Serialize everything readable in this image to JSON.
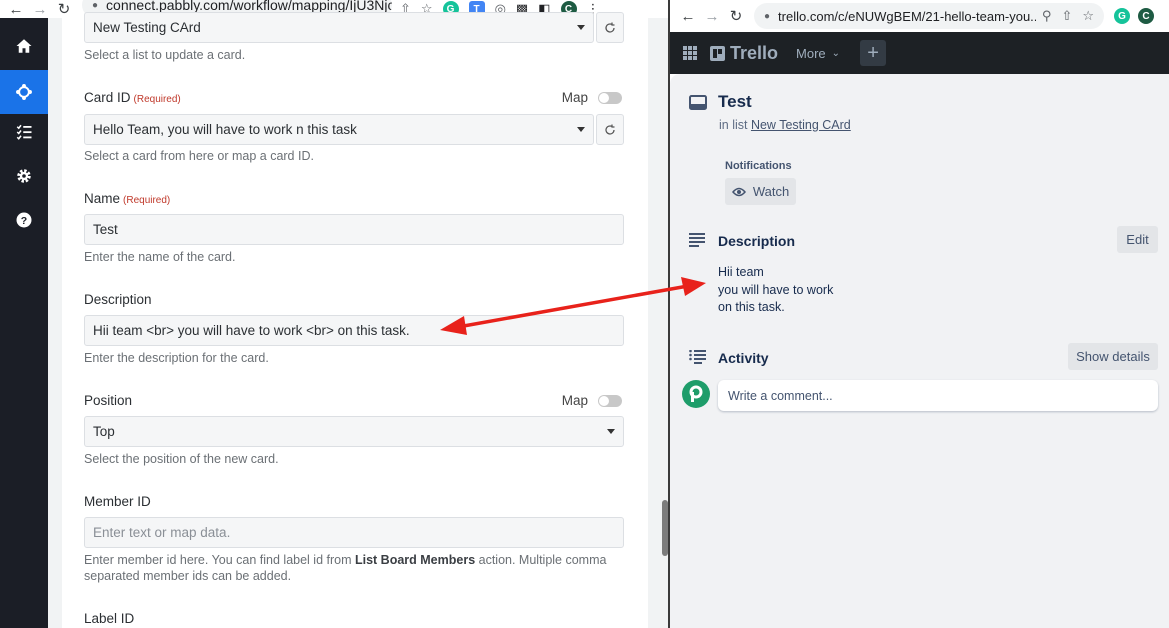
{
  "left_browser": {
    "url": "connect.pabbly.com/workflow/mapping/IjU3Njcw...",
    "profile_initial": "C"
  },
  "form": {
    "list_value": "New Testing CArd",
    "list_helper": "Select a list to update a card.",
    "card_id_label": "Card ID",
    "card_id_required": "(Required)",
    "card_id_map_label": "Map",
    "card_id_value": "Hello Team, you will have to work n this task",
    "card_id_helper": "Select a card from here or map a card ID.",
    "name_label": "Name",
    "name_required": "(Required)",
    "name_value": "Test",
    "name_helper": "Enter the name of the card.",
    "description_label": "Description",
    "description_value": "Hii team <br> you will have to work <br> on this task.",
    "description_helper": "Enter the description for the card.",
    "position_label": "Position",
    "position_map_label": "Map",
    "position_value": "Top",
    "position_helper": "Select the position of the new card.",
    "member_id_label": "Member ID",
    "member_id_placeholder": "Enter text or map data.",
    "member_helper_pre": "Enter member id here. You can find label id from ",
    "member_helper_bold": "List Board Members",
    "member_helper_post": " action. Multiple comma separated member ids can be added.",
    "label_id_label": "Label ID"
  },
  "right_browser": {
    "url": "trello.com/c/eNUWgBEM/21-hello-team-you...",
    "profile_initial": "C"
  },
  "trello": {
    "logo_text": "Trello",
    "more_label": "More",
    "plus_label": "+",
    "card_title": "Test",
    "in_list_prefix": "in list ",
    "list_name": "New Testing CArd",
    "notifications_label": "Notifications",
    "watch_label": "Watch",
    "description_heading": "Description",
    "edit_label": "Edit",
    "description_lines": [
      "Hii team",
      "you will have to work",
      "on this task."
    ],
    "activity_heading": "Activity",
    "show_details_label": "Show details",
    "comment_placeholder": "Write a comment..."
  },
  "colors": {
    "sidebar_bg": "#1b1e26",
    "sidebar_active": "#1a73e8",
    "required_red": "#c0392b",
    "trello_header": "#1d2125",
    "arrow_red": "#e8221b",
    "avatar_green": "#1e9d6a"
  }
}
